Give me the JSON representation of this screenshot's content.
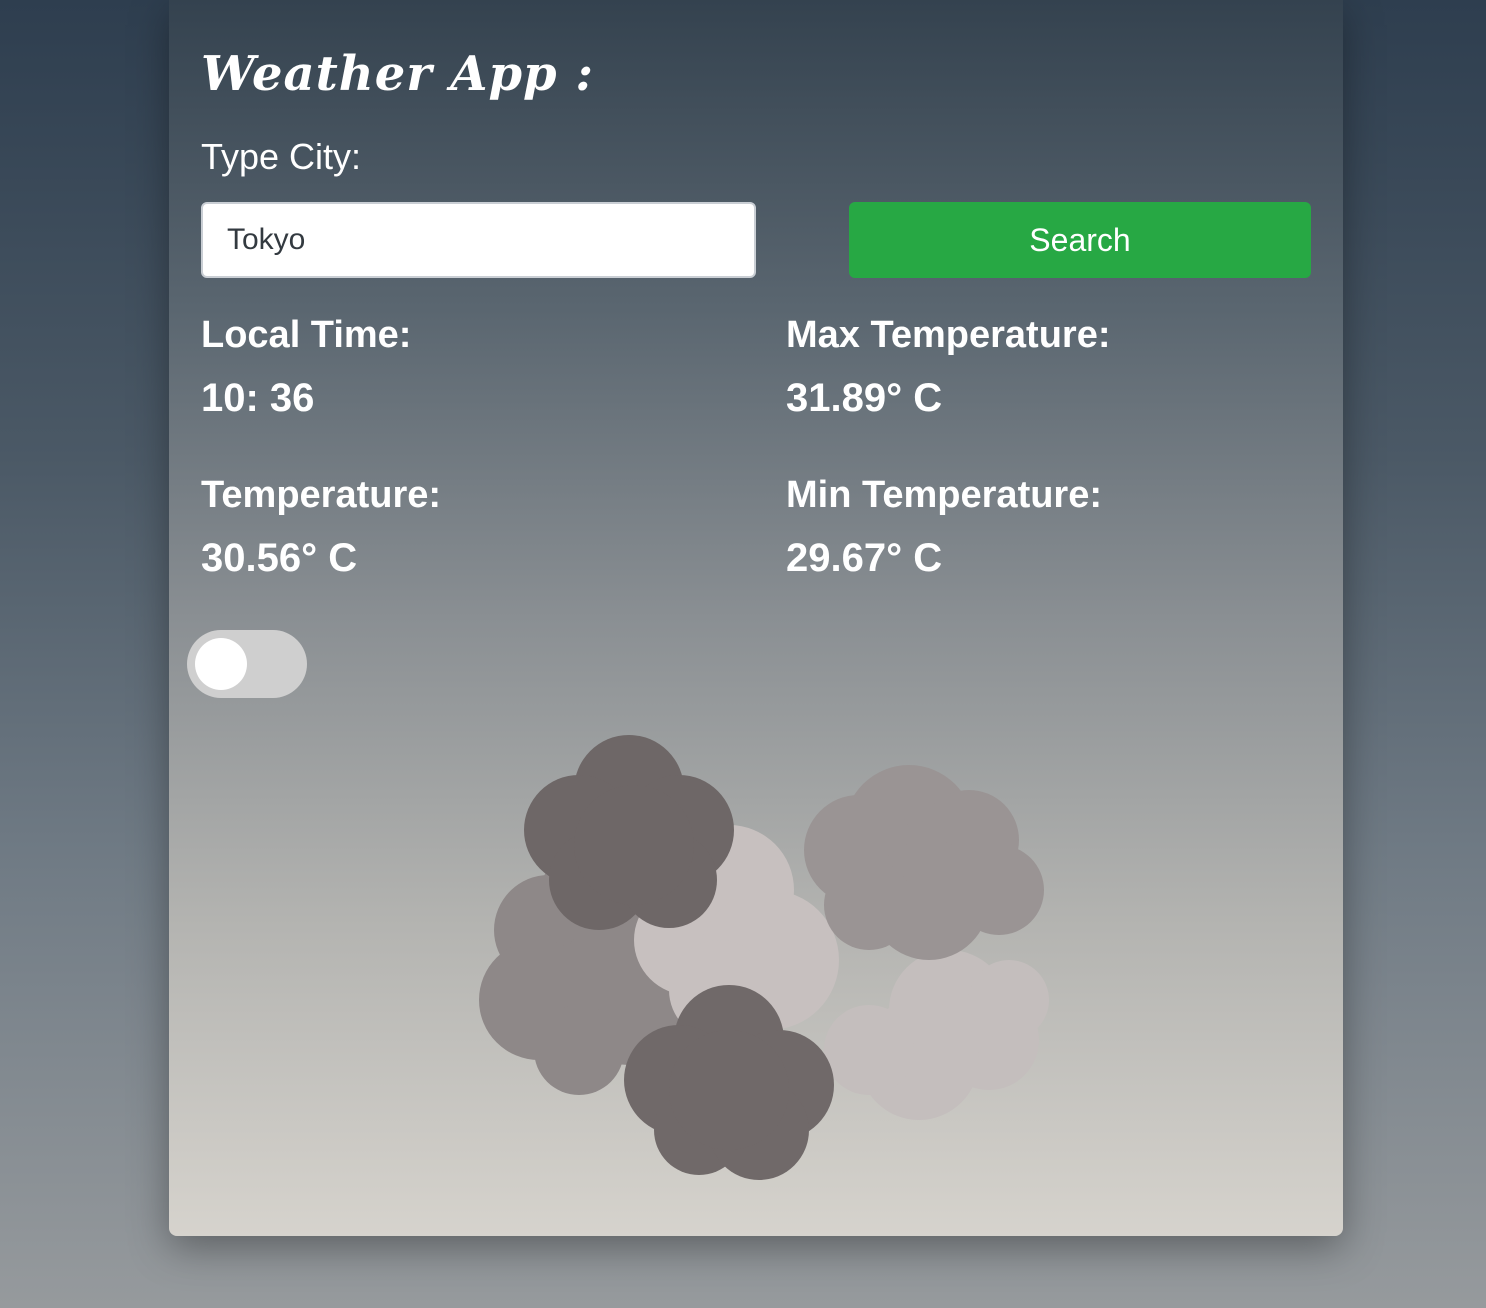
{
  "app": {
    "title": "Weather App :"
  },
  "search": {
    "label": "Type City:",
    "value": "Tokyo",
    "button_label": "Search"
  },
  "info": {
    "local_time_label": "Local Time:",
    "local_time_value": "10: 36",
    "temperature_label": "Temperature:",
    "temperature_value": "30.56° C",
    "max_temp_label": "Max Temperature:",
    "max_temp_value": "31.89° C",
    "min_temp_label": "Min Temperature:",
    "min_temp_value": "29.67° C"
  },
  "toggle": {
    "on": false
  },
  "illustration": {
    "icon": "cloudy-weather-icon"
  },
  "colors": {
    "search_button": "#27a844",
    "dark_cloud": "#6f6868",
    "light_cloud": "#c9c3c1"
  }
}
